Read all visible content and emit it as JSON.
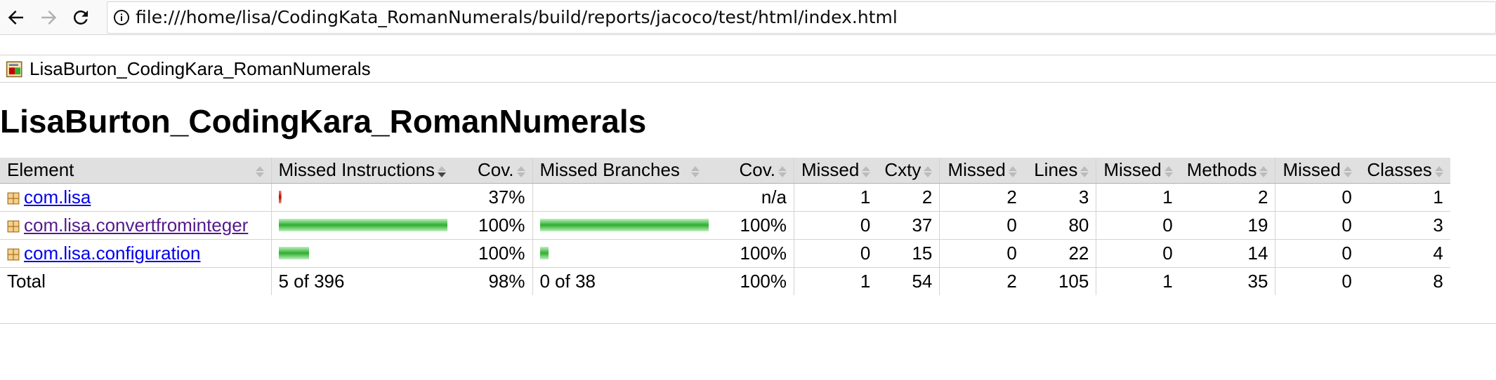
{
  "browser": {
    "url": "file:///home/lisa/CodingKata_RomanNumerals/build/reports/jacoco/test/html/index.html"
  },
  "breadcrumb": {
    "label": "LisaBurton_CodingKara_RomanNumerals"
  },
  "page": {
    "title": "LisaBurton_CodingKara_RomanNumerals"
  },
  "table": {
    "headers": {
      "element": "Element",
      "missed_instructions": "Missed Instructions",
      "cov_instr": "Cov.",
      "missed_branches": "Missed Branches",
      "cov_branch": "Cov.",
      "missed_cxty": "Missed",
      "cxty": "Cxty",
      "missed_lines": "Missed",
      "lines": "Lines",
      "missed_methods": "Missed",
      "methods": "Methods",
      "missed_classes": "Missed",
      "classes": "Classes"
    },
    "rows": [
      {
        "name": "com.lisa",
        "visited": false,
        "instr_missed_fraction": 0.63,
        "instr_covered_fraction": 0.37,
        "instr_bar_scale": 0.02,
        "instr_cov": "37%",
        "branch_missed_fraction": 0,
        "branch_covered_fraction": 0,
        "branch_bar_scale": 0,
        "branch_cov": "n/a",
        "missed_cxty": "1",
        "cxty": "2",
        "missed_lines": "2",
        "lines": "3",
        "missed_methods": "1",
        "methods": "2",
        "missed_classes": "0",
        "classes": "1"
      },
      {
        "name": "com.lisa.convertfrominteger",
        "visited": true,
        "instr_missed_fraction": 0,
        "instr_covered_fraction": 1,
        "instr_bar_scale": 1,
        "instr_cov": "100%",
        "branch_missed_fraction": 0,
        "branch_covered_fraction": 1,
        "branch_bar_scale": 1,
        "branch_cov": "100%",
        "missed_cxty": "0",
        "cxty": "37",
        "missed_lines": "0",
        "lines": "80",
        "missed_methods": "0",
        "methods": "19",
        "missed_classes": "0",
        "classes": "3"
      },
      {
        "name": "com.lisa.configuration",
        "visited": false,
        "instr_missed_fraction": 0,
        "instr_covered_fraction": 1,
        "instr_bar_scale": 0.18,
        "instr_cov": "100%",
        "branch_missed_fraction": 0,
        "branch_covered_fraction": 1,
        "branch_bar_scale": 0.05,
        "branch_cov": "100%",
        "missed_cxty": "0",
        "cxty": "15",
        "missed_lines": "0",
        "lines": "22",
        "missed_methods": "0",
        "methods": "14",
        "missed_classes": "0",
        "classes": "4"
      }
    ],
    "total": {
      "label": "Total",
      "instr": "5 of 396",
      "instr_cov": "98%",
      "branch": "0 of 38",
      "branch_cov": "100%",
      "missed_cxty": "1",
      "cxty": "54",
      "missed_lines": "2",
      "lines": "105",
      "missed_methods": "1",
      "methods": "35",
      "missed_classes": "0",
      "classes": "8"
    }
  },
  "colors": {
    "covered": "#2fae2f",
    "missed": "#c80000",
    "header_bg": "#e0e0e0",
    "link": "#0000ee",
    "visited_link": "#551a8b"
  }
}
